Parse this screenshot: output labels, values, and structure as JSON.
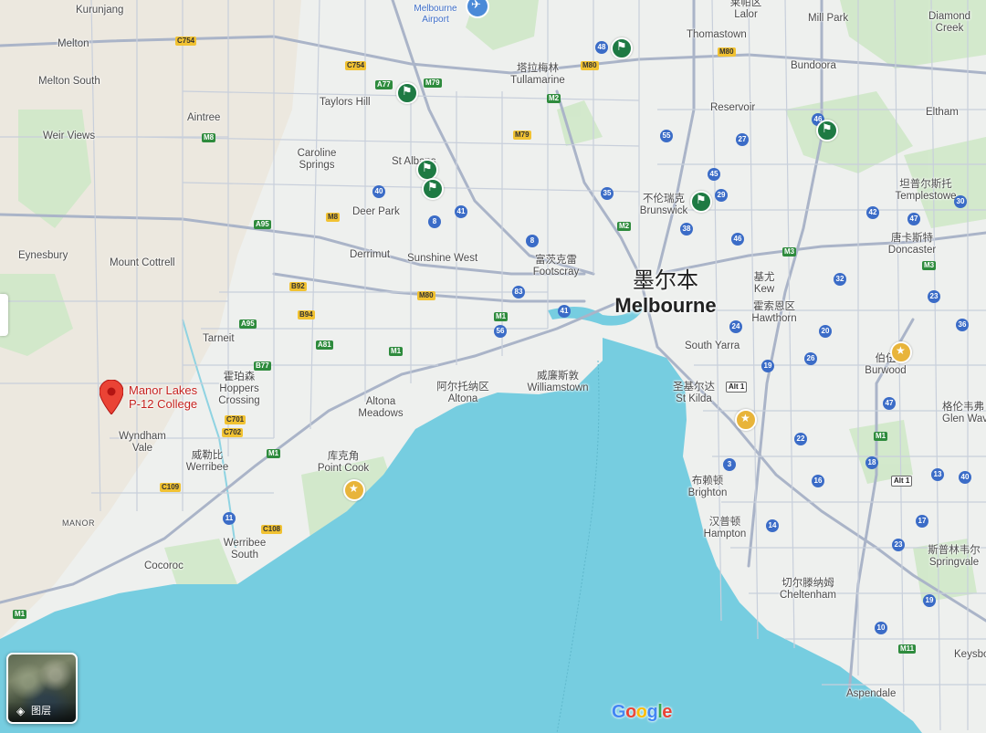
{
  "map": {
    "city": {
      "name_cn": "墨尔本",
      "name_en": "Melbourne"
    },
    "selected_place": {
      "name_line1": "Manor Lakes",
      "name_line2": "P-12 College"
    },
    "airport": {
      "name_line1": "Melbourne",
      "name_line2": "Airport"
    },
    "labels": [
      "Kurunjang",
      "Melton",
      "Melton South",
      "Aintree",
      "Weir Views",
      "Eynesbury",
      "Mount Cottrell",
      "Taylors Hill",
      "Caroline",
      "Springs",
      "St Albans",
      "Deer Park",
      "Derrimut",
      "Sunshine West",
      "塔拉梅林",
      "Tullamarine",
      "Thomastown",
      "莱帕区",
      "Lalor",
      "Mill Park",
      "Diamond",
      "Creek",
      "Bundoora",
      "Reservoir",
      "Eltham",
      "坦普尔斯托",
      "Templestowe",
      "不伦瑞克",
      "Brunswick",
      "富茨克雷",
      "Footscray",
      "唐卡斯特",
      "Doncaster",
      "基尤",
      "Kew",
      "霍索恩区",
      "Hawthorn",
      "South Yarra",
      "伯伍",
      "Burwood",
      "格伦韦弗",
      "Glen Wave",
      "圣基尔达",
      "St Kilda",
      "阿尔托纳区",
      "Altona",
      "威廉斯敦",
      "Williamstown",
      "Altona",
      "Meadows",
      "Tarneit",
      "霍珀森",
      "Hoppers",
      "Crossing",
      "Wyndham",
      "Vale",
      "威勒比",
      "Werribee",
      "库克角",
      "Point Cook",
      "MANOR",
      "Werribee",
      "South",
      "Cocoroc",
      "布赖顿",
      "Brighton",
      "汉普顿",
      "Hampton",
      "切尔滕纳姆",
      "Cheltenham",
      "斯普林韦尔",
      "Springvale",
      "Keysbo",
      "Aspendale"
    ],
    "road_shields": [
      "C754",
      "C754",
      "A77",
      "M79",
      "M80",
      "M2",
      "M79",
      "M8",
      "A95",
      "M8",
      "B92",
      "B94",
      "M80",
      "A95",
      "A81",
      "M1",
      "B77",
      "C701",
      "C702",
      "M1",
      "C109",
      "C108",
      "M1",
      "M1",
      "M2",
      "M3",
      "M3",
      "M80",
      "Alt 1",
      "Alt 1",
      "M1",
      "M11",
      "48",
      "55",
      "27",
      "46",
      "45",
      "29",
      "38",
      "46",
      "35",
      "40",
      "8",
      "41",
      "8",
      "83",
      "56",
      "41",
      "30",
      "42",
      "47",
      "32",
      "23",
      "36",
      "24",
      "20",
      "26",
      "19",
      "22",
      "47",
      "40",
      "16",
      "18",
      "13",
      "3",
      "14",
      "23",
      "17",
      "19",
      "10",
      "11"
    ]
  },
  "layers_button": {
    "label": "图层",
    "icon": "layers-icon"
  },
  "attribution": {
    "logo_text": "Google"
  },
  "colors": {
    "water": "#76cde0",
    "land": "#eef0ee",
    "park": "#cfe8c8",
    "road_major": "#aab4c8",
    "road_minor": "#c8cfdb",
    "pin": "#ea4335",
    "poi_green": "#1e7a43",
    "poi_star": "#e8b43a"
  }
}
